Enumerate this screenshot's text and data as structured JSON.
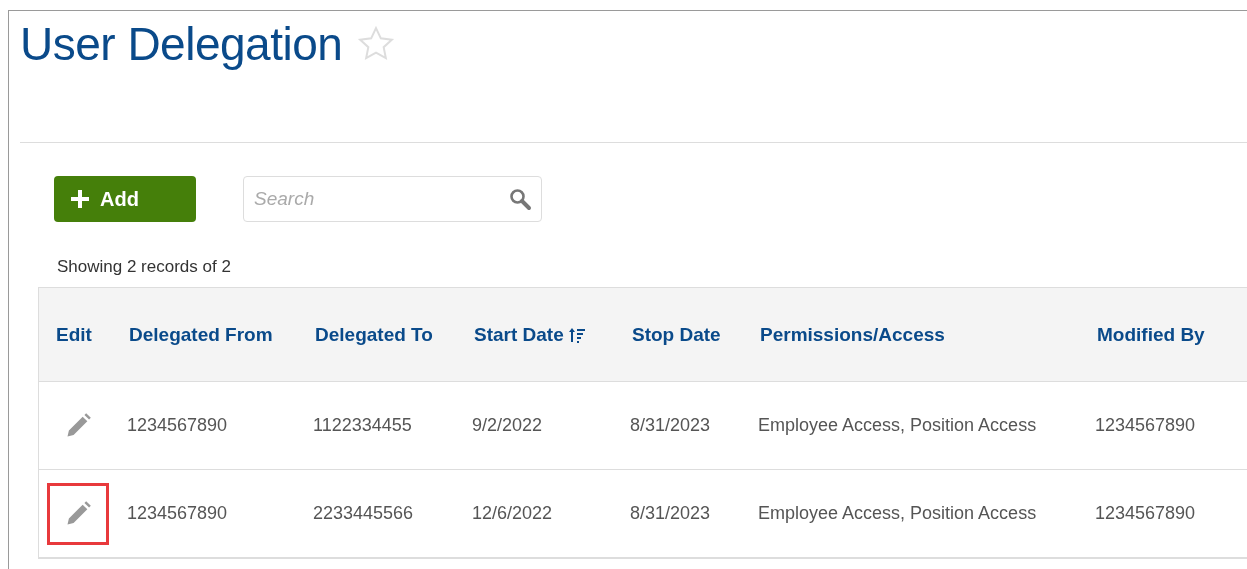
{
  "page": {
    "title": "User Delegation",
    "starred": false
  },
  "toolbar": {
    "add_button": "Add",
    "search": {
      "placeholder": "Search"
    }
  },
  "records_summary": "Showing 2 records of 2",
  "table": {
    "columns": [
      {
        "label": "Edit",
        "sorted": false
      },
      {
        "label": "Delegated From",
        "sorted": false
      },
      {
        "label": "Delegated To",
        "sorted": false
      },
      {
        "label": "Start Date",
        "sorted": true
      },
      {
        "label": "Stop Date",
        "sorted": false
      },
      {
        "label": "Permissions/Access",
        "sorted": false
      },
      {
        "label": "Modified By",
        "sorted": false
      }
    ],
    "rows": [
      {
        "highlighted": false,
        "cells": [
          "",
          "1234567890",
          "1122334455",
          "9/2/2022",
          "8/31/2023",
          "Employee Access, Position Access",
          "1234567890"
        ]
      },
      {
        "highlighted": true,
        "cells": [
          "",
          "1234567890",
          "2233445566",
          "12/6/2022",
          "8/31/2023",
          "Employee Access, Position Access",
          "1234567890"
        ]
      }
    ]
  }
}
